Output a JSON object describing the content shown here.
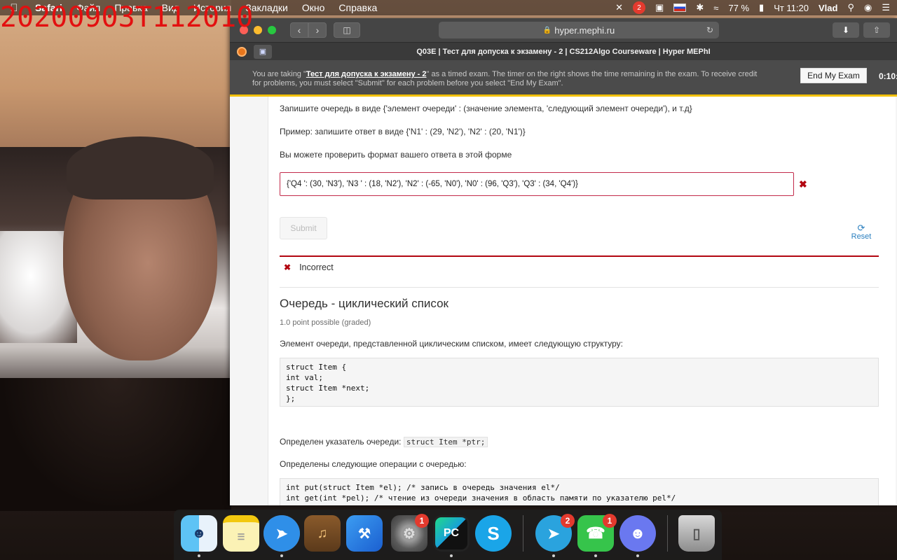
{
  "overlay": {
    "timestamp": "20200903T112010"
  },
  "menubar": {
    "apple": "",
    "app_name": "Safari",
    "items": [
      "Файл",
      "Правка",
      "Вид",
      "История",
      "Закладки",
      "Окно",
      "Справка"
    ],
    "battery": "77 %",
    "clock": "Чт 11:20",
    "user": "Vlad",
    "notification_badge": "2"
  },
  "browser": {
    "url": "hyper.mephi.ru",
    "tab_title": "Q03E | Тест для допуска к экзамену - 2 | CS212Algo Courseware | Hyper MEPhI"
  },
  "exam_banner": {
    "text_before": "You are taking \"",
    "exam_name": "Тест для допуска к экзамену - 2",
    "text_after": "\" as a timed exam. The timer on the right shows the time remaining in the exam. To receive credit for problems, you must select \"Submit\" for each problem before you select \"End My Exam\".",
    "end_button": "End My Exam",
    "timer": "0:10:"
  },
  "problem1": {
    "instruction": "Запишите очередь в виде {'элемент очереди' : (значение элемента, 'следующий элемент очереди'), и т.д}",
    "example": "Пример: запишите ответ в виде {'N1' : (29, 'N2'), 'N2' : (20, 'N1')}",
    "check_hint": "Вы можете проверить формат вашего ответа в этой форме",
    "answer_value": "{'Q4 ': (30,  'N3'), 'N3 ' : (18, 'N2'), 'N2' : (-65, 'N0'), 'N0' : (96, 'Q3'), 'Q3' : (34, 'Q4')}",
    "submit_label": "Submit",
    "reset_label": "Reset",
    "result_label": "Incorrect"
  },
  "problem2": {
    "title": "Очередь - циклический список",
    "points": "1.0 point possible (graded)",
    "description": "Элемент очереди, представленной циклическим списком, имеет следующую структуру:",
    "struct_code": "struct Item {\nint val;\nstruct Item *next;\n};",
    "pointer_text": "Определен указатель очереди:",
    "pointer_code": "struct Item *ptr;",
    "ops_text": "Определены следующие операции с очередью:",
    "ops_code": "int put(struct Item *el); /* запись в очередь значения el*/\nint get(int *pel); /* чтение из очереди значения в область памяти по указателю pel*/"
  },
  "dock": {
    "apps": [
      {
        "name": "Finder",
        "badge": ""
      },
      {
        "name": "Notes",
        "badge": ""
      },
      {
        "name": "Safari",
        "badge": ""
      },
      {
        "name": "Garage",
        "badge": ""
      },
      {
        "name": "Xcode",
        "badge": ""
      },
      {
        "name": "System Preferences",
        "badge": "1"
      },
      {
        "name": "PyCharm",
        "badge": ""
      },
      {
        "name": "Skype",
        "badge": ""
      },
      {
        "name": "Telegram",
        "badge": "2"
      },
      {
        "name": "FaceTime",
        "badge": "1"
      },
      {
        "name": "Discord",
        "badge": ""
      },
      {
        "name": "Trash",
        "badge": ""
      }
    ],
    "pycharm_label": "PC"
  }
}
